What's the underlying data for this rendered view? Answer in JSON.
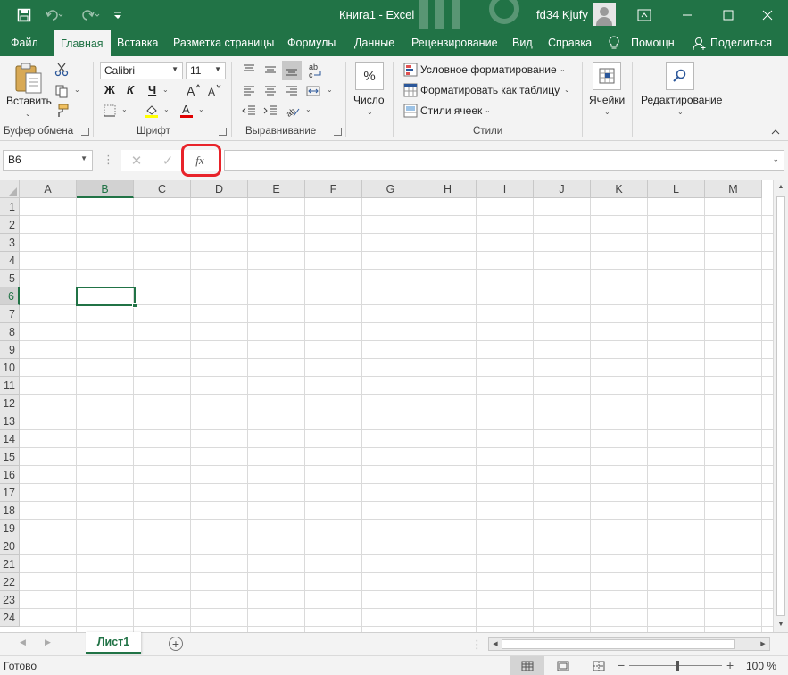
{
  "titlebar": {
    "title": "Книга1  -  Excel",
    "user": "fd34 Kjufy",
    "bg_color": "#217346"
  },
  "tabs": [
    "Файл",
    "Главная",
    "Вставка",
    "Разметка страницы",
    "Формулы",
    "Данные",
    "Рецензирование",
    "Вид",
    "Справка",
    "Помощн",
    "Поделиться"
  ],
  "active_tab": "Главная",
  "ribbon": {
    "clipboard": {
      "paste_label": "Вставить",
      "group_label": "Буфер обмена"
    },
    "font": {
      "font_name": "Calibri",
      "font_size": "11",
      "bold": "Ж",
      "italic": "К",
      "underline": "Ч",
      "group_label": "Шрифт"
    },
    "alignment": {
      "group_label": "Выравнивание"
    },
    "number": {
      "label": "Число",
      "symbol": "%"
    },
    "styles": {
      "conditional": "Условное форматирование",
      "format_table": "Форматировать как таблицу",
      "cell_styles": "Стили ячеек",
      "group_label": "Стили"
    },
    "cells": {
      "label": "Ячейки"
    },
    "editing": {
      "label": "Редактирование"
    }
  },
  "formula_bar": {
    "name_box": "B6",
    "fx_label": "fx",
    "highlight_color": "#e8232a",
    "formula": ""
  },
  "grid": {
    "columns": [
      "A",
      "B",
      "C",
      "D",
      "E",
      "F",
      "G",
      "H",
      "I",
      "J",
      "K",
      "L",
      "M"
    ],
    "rows": [
      "1",
      "2",
      "3",
      "4",
      "5",
      "6",
      "7",
      "8",
      "9",
      "10",
      "11",
      "12",
      "13",
      "14",
      "15",
      "16",
      "17",
      "18",
      "19",
      "20",
      "21",
      "22",
      "23",
      "24"
    ],
    "selected_column": "B",
    "selected_row": "6",
    "accent_color": "#217346"
  },
  "sheets": {
    "tabs": [
      "Лист1"
    ],
    "active": "Лист1"
  },
  "status": {
    "text": "Готово",
    "zoom": "100 %"
  }
}
